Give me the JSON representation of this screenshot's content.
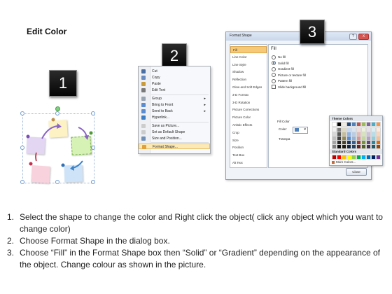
{
  "page_title": "Edit Color",
  "badges": {
    "b1": "1",
    "b2": "2",
    "b3": "3"
  },
  "context_menu": {
    "items": [
      {
        "label": "Cut",
        "icon": "scissors-icon",
        "color": "#4a6fa5"
      },
      {
        "label": "Copy",
        "icon": "copy-icon",
        "color": "#6b8cc0"
      },
      {
        "label": "Paste",
        "icon": "paste-icon",
        "color": "#c89b3c"
      },
      {
        "label": "Edit Text",
        "icon": "text-icon",
        "color": "#7a7a7a"
      },
      {
        "label": "Group",
        "icon": "group-icon",
        "color": "#9aa5b4",
        "arrow": "▸"
      },
      {
        "label": "Bring to Front",
        "icon": "bring-front-icon",
        "color": "#5b8bd0",
        "arrow": "▸"
      },
      {
        "label": "Send to Back",
        "icon": "send-back-icon",
        "color": "#5b8bd0",
        "arrow": "▸"
      },
      {
        "label": "Hyperlink...",
        "icon": "hyperlink-icon",
        "color": "#3c7dc4"
      },
      {
        "label": "Save as Picture...",
        "icon": "picture-icon",
        "color": "#cccccc"
      },
      {
        "label": "Set as Default Shape",
        "icon": "default-shape-icon",
        "color": "#cccccc"
      },
      {
        "label": "Size and Position...",
        "icon": "size-icon",
        "color": "#6f8fb8"
      },
      {
        "label": "Format Shape...",
        "icon": "format-shape-icon",
        "color": "#e0a13a"
      }
    ]
  },
  "dialog": {
    "title": "Format Shape",
    "help": "?",
    "close": "X",
    "nav": [
      "Fill",
      "Line Color",
      "Line Style",
      "Shadow",
      "Reflection",
      "Glow and Soft Edges",
      "3-D Format",
      "3-D Rotation",
      "Picture Corrections",
      "Picture Color",
      "Artistic Effects",
      "Crop",
      "Size",
      "Position",
      "Text Box",
      "Alt Text"
    ],
    "fill_heading": "Fill",
    "options": [
      "No fill",
      "Solid fill",
      "Gradient fill",
      "Picture or texture fill",
      "Pattern fill",
      "Slide background fill"
    ],
    "fill_color_label": "Fill Color",
    "color_label": "Color:",
    "transparency_label": "Transpa",
    "theme_colors_label": "Theme Colors",
    "standard_colors_label": "Standard Colors",
    "more_colors_label": "More Colors...",
    "close_button": "Close",
    "theme_top": [
      "#ffffff",
      "#000000",
      "#eeece1",
      "#1f497d",
      "#4f81bd",
      "#c0504d",
      "#9bbb59",
      "#8064a2",
      "#4bacc6",
      "#f79646"
    ],
    "theme_columns": [
      [
        "#f2f2f2",
        "#d8d8d8",
        "#bfbfbf",
        "#a5a5a5",
        "#7f7f7f"
      ],
      [
        "#7f7f7f",
        "#595959",
        "#3f3f3f",
        "#262626",
        "#0c0c0c"
      ],
      [
        "#ddd9c3",
        "#c4bd97",
        "#938953",
        "#494429",
        "#1d1b10"
      ],
      [
        "#c6d9f0",
        "#8db3e2",
        "#548dd4",
        "#17365d",
        "#0f243e"
      ],
      [
        "#dbe5f1",
        "#b8cce4",
        "#95b3d7",
        "#366092",
        "#244061"
      ],
      [
        "#f2dcdb",
        "#e5b9b7",
        "#d99694",
        "#953734",
        "#632423"
      ],
      [
        "#ebf1dd",
        "#d7e3bc",
        "#c3d69b",
        "#76923c",
        "#4f6128"
      ],
      [
        "#e5e0ec",
        "#ccc1d9",
        "#b2a2c7",
        "#5f497a",
        "#3f3151"
      ],
      [
        "#dbeef3",
        "#b7dde8",
        "#92cddc",
        "#31859b",
        "#205867"
      ],
      [
        "#fdeada",
        "#fbd5b5",
        "#fac08f",
        "#e36c09",
        "#974806"
      ]
    ],
    "standard": [
      "#c00000",
      "#ff0000",
      "#ffc000",
      "#ffff00",
      "#92d050",
      "#00b050",
      "#00b0f0",
      "#0070c0",
      "#002060",
      "#7030a0"
    ]
  },
  "steps": [
    {
      "num": "1.",
      "text": "Select the shape to change the color and Right click the object( click any object which you want to change color)"
    },
    {
      "num": "2.",
      "text": "Choose Format Shape in the dialog box."
    },
    {
      "num": "3.",
      "text": "Choose “Fill” in the Format Shape box then “Solid” or “Gradient” depending on the appearance of the object. Change colour as shown in the picture."
    }
  ]
}
